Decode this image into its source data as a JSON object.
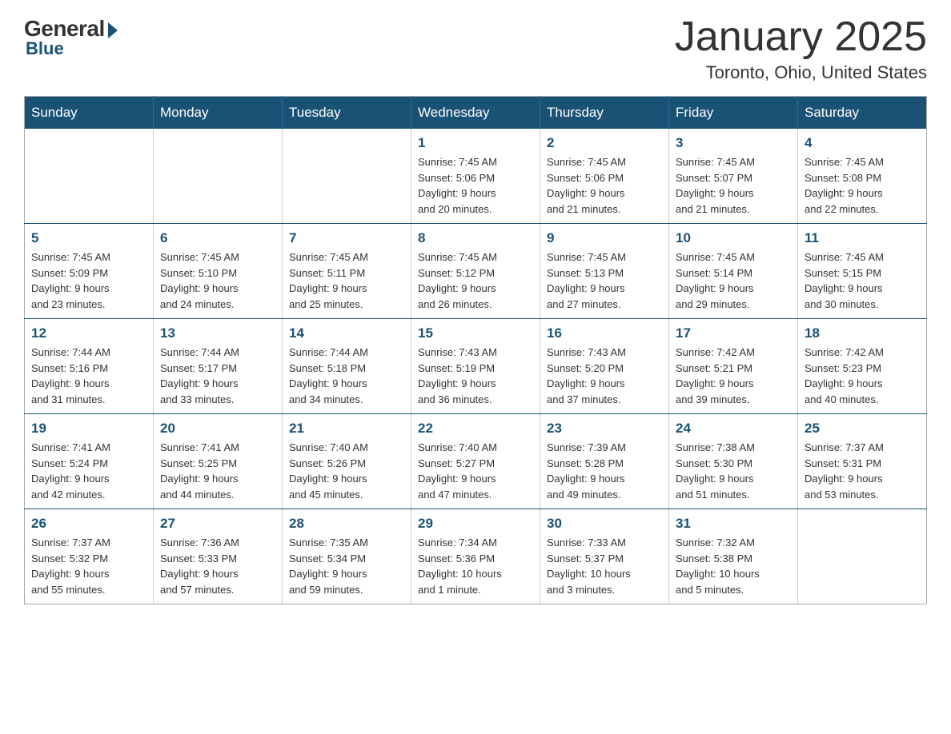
{
  "logo": {
    "general": "General",
    "blue": "Blue"
  },
  "title": "January 2025",
  "location": "Toronto, Ohio, United States",
  "days_of_week": [
    "Sunday",
    "Monday",
    "Tuesday",
    "Wednesday",
    "Thursday",
    "Friday",
    "Saturday"
  ],
  "weeks": [
    [
      {
        "day": "",
        "info": ""
      },
      {
        "day": "",
        "info": ""
      },
      {
        "day": "",
        "info": ""
      },
      {
        "day": "1",
        "info": "Sunrise: 7:45 AM\nSunset: 5:06 PM\nDaylight: 9 hours\nand 20 minutes."
      },
      {
        "day": "2",
        "info": "Sunrise: 7:45 AM\nSunset: 5:06 PM\nDaylight: 9 hours\nand 21 minutes."
      },
      {
        "day": "3",
        "info": "Sunrise: 7:45 AM\nSunset: 5:07 PM\nDaylight: 9 hours\nand 21 minutes."
      },
      {
        "day": "4",
        "info": "Sunrise: 7:45 AM\nSunset: 5:08 PM\nDaylight: 9 hours\nand 22 minutes."
      }
    ],
    [
      {
        "day": "5",
        "info": "Sunrise: 7:45 AM\nSunset: 5:09 PM\nDaylight: 9 hours\nand 23 minutes."
      },
      {
        "day": "6",
        "info": "Sunrise: 7:45 AM\nSunset: 5:10 PM\nDaylight: 9 hours\nand 24 minutes."
      },
      {
        "day": "7",
        "info": "Sunrise: 7:45 AM\nSunset: 5:11 PM\nDaylight: 9 hours\nand 25 minutes."
      },
      {
        "day": "8",
        "info": "Sunrise: 7:45 AM\nSunset: 5:12 PM\nDaylight: 9 hours\nand 26 minutes."
      },
      {
        "day": "9",
        "info": "Sunrise: 7:45 AM\nSunset: 5:13 PM\nDaylight: 9 hours\nand 27 minutes."
      },
      {
        "day": "10",
        "info": "Sunrise: 7:45 AM\nSunset: 5:14 PM\nDaylight: 9 hours\nand 29 minutes."
      },
      {
        "day": "11",
        "info": "Sunrise: 7:45 AM\nSunset: 5:15 PM\nDaylight: 9 hours\nand 30 minutes."
      }
    ],
    [
      {
        "day": "12",
        "info": "Sunrise: 7:44 AM\nSunset: 5:16 PM\nDaylight: 9 hours\nand 31 minutes."
      },
      {
        "day": "13",
        "info": "Sunrise: 7:44 AM\nSunset: 5:17 PM\nDaylight: 9 hours\nand 33 minutes."
      },
      {
        "day": "14",
        "info": "Sunrise: 7:44 AM\nSunset: 5:18 PM\nDaylight: 9 hours\nand 34 minutes."
      },
      {
        "day": "15",
        "info": "Sunrise: 7:43 AM\nSunset: 5:19 PM\nDaylight: 9 hours\nand 36 minutes."
      },
      {
        "day": "16",
        "info": "Sunrise: 7:43 AM\nSunset: 5:20 PM\nDaylight: 9 hours\nand 37 minutes."
      },
      {
        "day": "17",
        "info": "Sunrise: 7:42 AM\nSunset: 5:21 PM\nDaylight: 9 hours\nand 39 minutes."
      },
      {
        "day": "18",
        "info": "Sunrise: 7:42 AM\nSunset: 5:23 PM\nDaylight: 9 hours\nand 40 minutes."
      }
    ],
    [
      {
        "day": "19",
        "info": "Sunrise: 7:41 AM\nSunset: 5:24 PM\nDaylight: 9 hours\nand 42 minutes."
      },
      {
        "day": "20",
        "info": "Sunrise: 7:41 AM\nSunset: 5:25 PM\nDaylight: 9 hours\nand 44 minutes."
      },
      {
        "day": "21",
        "info": "Sunrise: 7:40 AM\nSunset: 5:26 PM\nDaylight: 9 hours\nand 45 minutes."
      },
      {
        "day": "22",
        "info": "Sunrise: 7:40 AM\nSunset: 5:27 PM\nDaylight: 9 hours\nand 47 minutes."
      },
      {
        "day": "23",
        "info": "Sunrise: 7:39 AM\nSunset: 5:28 PM\nDaylight: 9 hours\nand 49 minutes."
      },
      {
        "day": "24",
        "info": "Sunrise: 7:38 AM\nSunset: 5:30 PM\nDaylight: 9 hours\nand 51 minutes."
      },
      {
        "day": "25",
        "info": "Sunrise: 7:37 AM\nSunset: 5:31 PM\nDaylight: 9 hours\nand 53 minutes."
      }
    ],
    [
      {
        "day": "26",
        "info": "Sunrise: 7:37 AM\nSunset: 5:32 PM\nDaylight: 9 hours\nand 55 minutes."
      },
      {
        "day": "27",
        "info": "Sunrise: 7:36 AM\nSunset: 5:33 PM\nDaylight: 9 hours\nand 57 minutes."
      },
      {
        "day": "28",
        "info": "Sunrise: 7:35 AM\nSunset: 5:34 PM\nDaylight: 9 hours\nand 59 minutes."
      },
      {
        "day": "29",
        "info": "Sunrise: 7:34 AM\nSunset: 5:36 PM\nDaylight: 10 hours\nand 1 minute."
      },
      {
        "day": "30",
        "info": "Sunrise: 7:33 AM\nSunset: 5:37 PM\nDaylight: 10 hours\nand 3 minutes."
      },
      {
        "day": "31",
        "info": "Sunrise: 7:32 AM\nSunset: 5:38 PM\nDaylight: 10 hours\nand 5 minutes."
      },
      {
        "day": "",
        "info": ""
      }
    ]
  ]
}
